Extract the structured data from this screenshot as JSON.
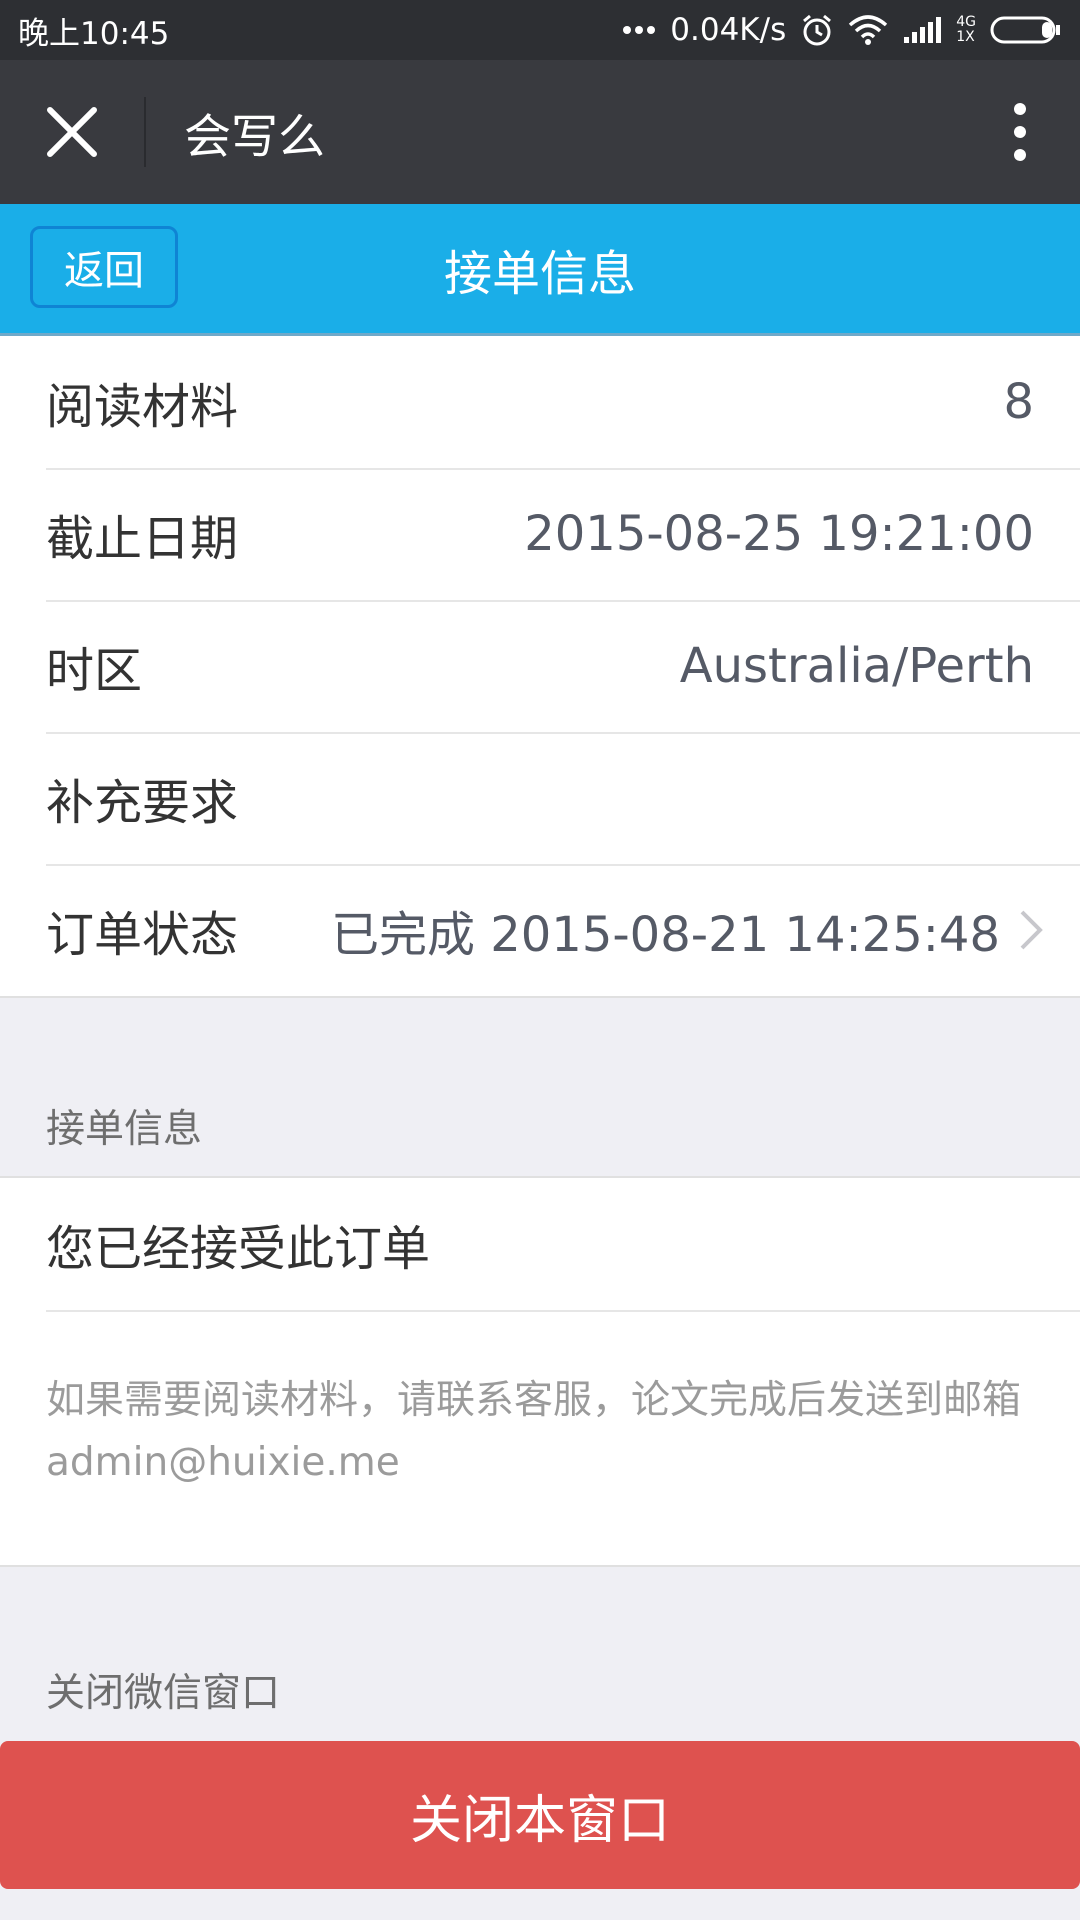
{
  "status_bar": {
    "time": "晚上10:45",
    "network_speed": "0.04K/s",
    "network_type": "4G",
    "sim_label": "1X"
  },
  "title_bar": {
    "app_title": "会写么"
  },
  "nav_bar": {
    "back_label": "返回",
    "title": "接单信息"
  },
  "order_details": [
    {
      "label": "阅读材料",
      "value": "8"
    },
    {
      "label": "截止日期",
      "value": "2015-08-25 19:21:00"
    },
    {
      "label": "时区",
      "value": "Australia/Perth"
    },
    {
      "label": "补充要求",
      "value": ""
    },
    {
      "label": "订单状态",
      "value": "已完成 2015-08-21 14:25:48"
    }
  ],
  "accept_section": {
    "header": "接单信息",
    "status_text": "您已经接受此订单",
    "note": "如果需要阅读材料，请联系客服，论文完成后发送到邮箱admin@huixie.me"
  },
  "close_section": {
    "header": "关闭微信窗口",
    "button_label": "关闭本窗口"
  },
  "colors": {
    "nav_blue": "#1aaee8",
    "close_red": "#de524f",
    "title_bar": "#393a3f",
    "status_bar": "#2d2f33"
  }
}
